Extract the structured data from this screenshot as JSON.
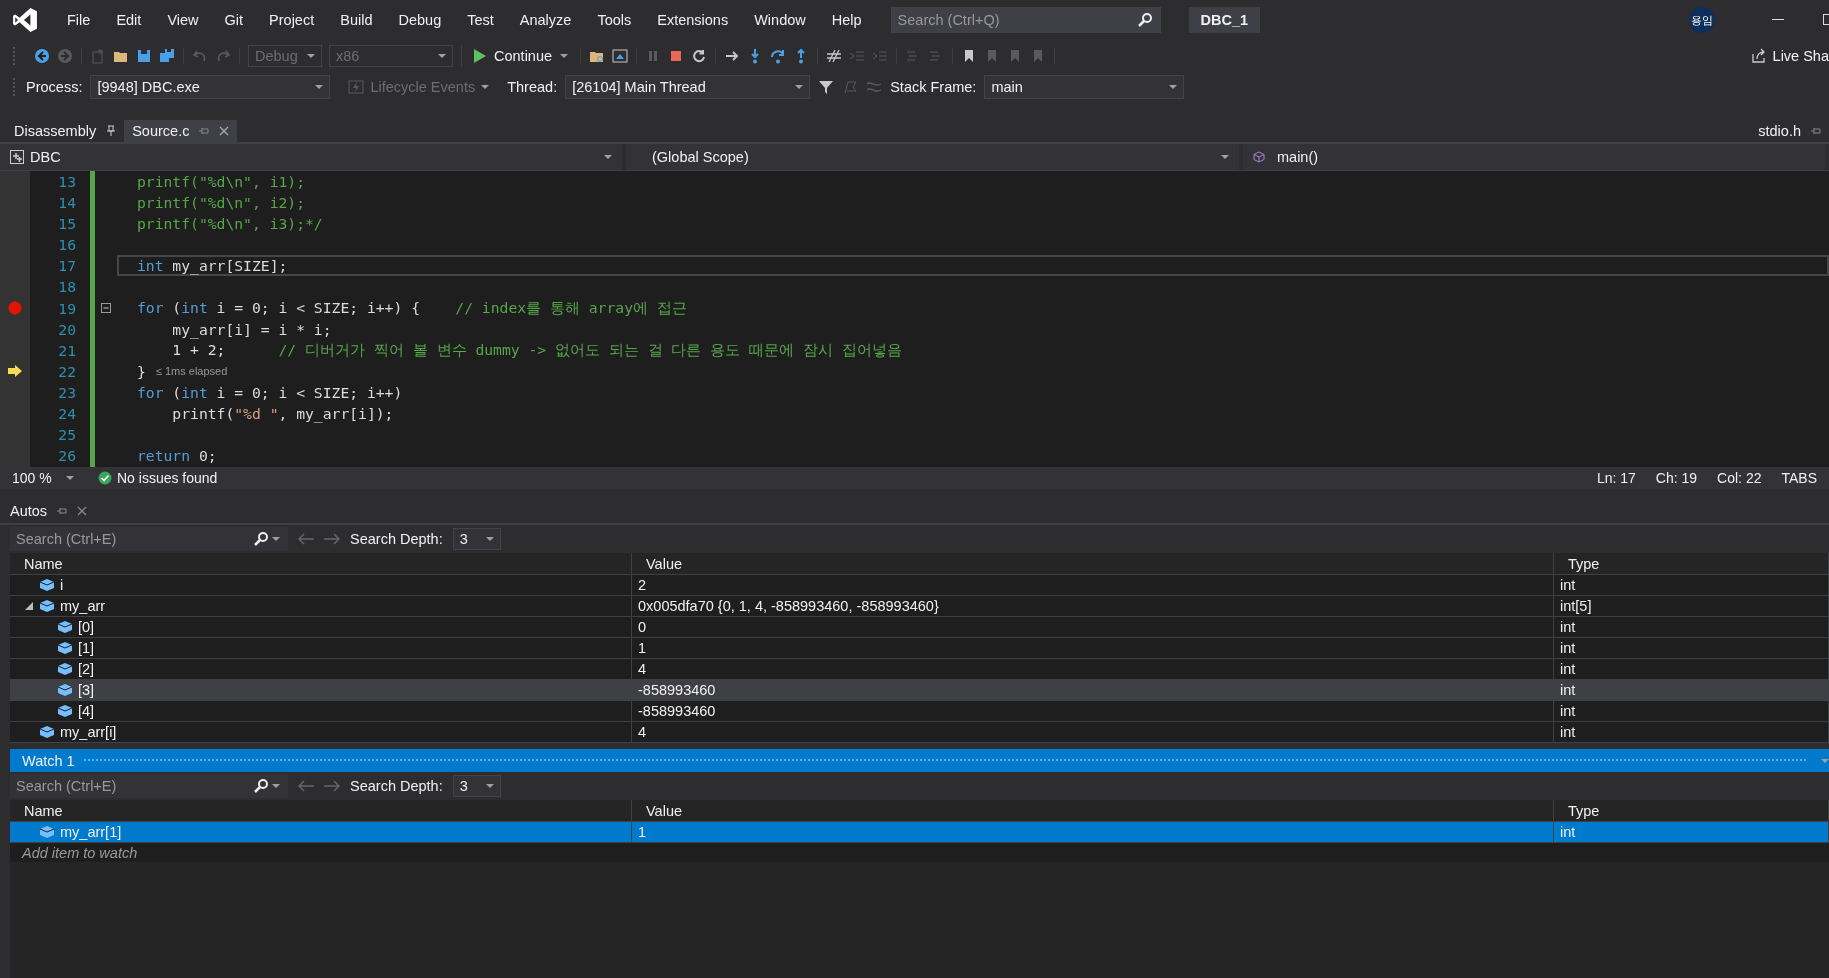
{
  "title_bar": {
    "menu": [
      "File",
      "Edit",
      "View",
      "Git",
      "Project",
      "Build",
      "Debug",
      "Test",
      "Analyze",
      "Tools",
      "Extensions",
      "Window",
      "Help"
    ],
    "search": {
      "placeholder": "Search (Ctrl+Q)"
    },
    "solution_name": "DBC_1",
    "account_initials": "용임"
  },
  "toolbar": [
    [
      {
        "kind": "back",
        "disabled": false
      },
      {
        "kind": "forward",
        "disabled": true
      }
    ],
    [
      {
        "kind": "new-item",
        "disabled": true
      },
      {
        "kind": "open",
        "disabled": false
      },
      {
        "kind": "save",
        "disabled": false
      },
      {
        "kind": "save-all",
        "disabled": false
      }
    ],
    [
      {
        "kind": "undo",
        "disabled": true
      },
      {
        "kind": "redo",
        "disabled": true
      }
    ],
    [
      {
        "kind": "combo",
        "label": "Debug",
        "disabled": true
      },
      {
        "kind": "combo",
        "label": "x86",
        "disabled": true
      }
    ],
    [
      {
        "kind": "continue",
        "label": "Continue",
        "disabled": false
      }
    ],
    [
      {
        "kind": "find-folder",
        "disabled": false
      },
      {
        "kind": "browser",
        "disabled": false
      }
    ],
    [
      {
        "kind": "pause",
        "disabled": true
      },
      {
        "kind": "stop",
        "disabled": false
      },
      {
        "kind": "restart",
        "disabled": false
      }
    ],
    [
      {
        "kind": "show-next",
        "disabled": false
      },
      {
        "kind": "step-into",
        "disabled": false
      },
      {
        "kind": "step-over",
        "disabled": false
      },
      {
        "kind": "step-out",
        "disabled": false
      }
    ],
    [
      {
        "kind": "hex",
        "disabled": false
      },
      {
        "kind": "outdent",
        "disabled": true
      },
      {
        "kind": "indent",
        "disabled": true
      }
    ],
    [
      {
        "kind": "comment",
        "disabled": true
      },
      {
        "kind": "uncomment",
        "disabled": true
      }
    ],
    [
      {
        "kind": "bookmark",
        "disabled": false
      },
      {
        "kind": "bookmark-prev",
        "disabled": true
      },
      {
        "kind": "bookmark-next",
        "disabled": true
      },
      {
        "kind": "bookmark-clear",
        "disabled": true
      }
    ]
  ],
  "live_share": "Live Sha",
  "debug_location": [
    {
      "kind": "label",
      "text": "Process:"
    },
    {
      "kind": "combo",
      "label": "[9948] DBC.exe",
      "disabled": false
    },
    {
      "kind": "lifecycle",
      "label": "Lifecycle Events",
      "disabled": true
    },
    {
      "kind": "label",
      "text": "Thread:"
    },
    {
      "kind": "combo",
      "label": "[26104] Main Thread",
      "disabled": false
    },
    {
      "kind": "filter",
      "disabled": false
    },
    {
      "kind": "flag",
      "disabled": true
    },
    {
      "kind": "threads",
      "disabled": true
    },
    {
      "kind": "label",
      "text": "Stack Frame:"
    },
    {
      "kind": "combo",
      "label": "main",
      "disabled": false
    }
  ],
  "document_tabs": [
    {
      "label": "Disassembly",
      "selected": false,
      "pinned": true
    },
    {
      "label": "Source.c",
      "selected": true,
      "pinned": false
    }
  ],
  "preview_tab": {
    "label": "stdio.h"
  },
  "navigation_bar": {
    "project": "DBC",
    "scope": "(Global Scope)",
    "member": "main()"
  },
  "code_lines": [
    {
      "number": "13",
      "current": false,
      "fold": false,
      "breakpoint": false,
      "execution_point": false,
      "tokens": [
        {
          "kind": "comment",
          "text": "printf(\"%d\\n\", i1);"
        }
      ]
    },
    {
      "number": "14",
      "current": false,
      "fold": false,
      "breakpoint": false,
      "execution_point": false,
      "tokens": [
        {
          "kind": "comment",
          "text": "printf(\"%d\\n\", i2);"
        }
      ]
    },
    {
      "number": "15",
      "current": false,
      "fold": false,
      "breakpoint": false,
      "execution_point": false,
      "tokens": [
        {
          "kind": "comment",
          "text": "printf(\"%d\\n\", i3);*/"
        }
      ]
    },
    {
      "number": "16",
      "current": false,
      "fold": false,
      "breakpoint": false,
      "execution_point": false
    },
    {
      "number": "17",
      "current": true,
      "fold": false,
      "breakpoint": false,
      "execution_point": false,
      "tokens": [
        {
          "kind": "keyword",
          "text": "int"
        },
        {
          "kind": "plain",
          "text": " my_arr[SIZE];"
        }
      ]
    },
    {
      "number": "18",
      "current": false,
      "fold": false,
      "breakpoint": false,
      "execution_point": false
    },
    {
      "number": "19",
      "current": false,
      "fold": true,
      "breakpoint": true,
      "execution_point": false,
      "tokens": [
        {
          "kind": "keyword",
          "text": "for"
        },
        {
          "kind": "plain",
          "text": " ("
        },
        {
          "kind": "keyword",
          "text": "int"
        },
        {
          "kind": "plain",
          "text": " i = 0; i < SIZE; i++) {    "
        },
        {
          "kind": "comment",
          "text": "// index를 통해 array에 접근"
        }
      ]
    },
    {
      "number": "20",
      "current": false,
      "fold": false,
      "breakpoint": false,
      "execution_point": false,
      "tokens": [
        {
          "kind": "plain",
          "text": "    my_arr[i] = i * i;"
        }
      ]
    },
    {
      "number": "21",
      "current": false,
      "fold": false,
      "breakpoint": false,
      "execution_point": false,
      "tokens": [
        {
          "kind": "plain",
          "text": "    1 + 2;      "
        },
        {
          "kind": "comment",
          "text": "// 디버거가 찍어 볼 변수 dummy -> 없어도 되는 걸 다른 용도 때문에 잠시 집어넣음"
        }
      ]
    },
    {
      "number": "22",
      "current": false,
      "fold": false,
      "breakpoint": false,
      "execution_point": true,
      "tokens": [
        {
          "kind": "plain",
          "text": "}"
        }
      ],
      "tip": "≤ 1ms elapsed"
    },
    {
      "number": "23",
      "current": false,
      "fold": false,
      "breakpoint": false,
      "execution_point": false,
      "tokens": [
        {
          "kind": "keyword",
          "text": "for"
        },
        {
          "kind": "plain",
          "text": " ("
        },
        {
          "kind": "keyword",
          "text": "int"
        },
        {
          "kind": "plain",
          "text": " i = 0; i < SIZE; i++)"
        }
      ]
    },
    {
      "number": "24",
      "current": false,
      "fold": false,
      "breakpoint": false,
      "execution_point": false,
      "tokens": [
        {
          "kind": "plain",
          "text": "    printf("
        },
        {
          "kind": "string",
          "text": "\"%d \""
        },
        {
          "kind": "plain",
          "text": ", my_arr[i]);"
        }
      ]
    },
    {
      "number": "25",
      "current": false,
      "fold": false,
      "breakpoint": false,
      "execution_point": false
    },
    {
      "number": "26",
      "current": false,
      "fold": false,
      "breakpoint": false,
      "execution_point": false,
      "tokens": [
        {
          "kind": "keyword",
          "text": "return"
        },
        {
          "kind": "plain",
          "text": " 0;"
        }
      ]
    }
  ],
  "editor_status": {
    "zoom": "100 %",
    "issues": "No issues found",
    "line": "Ln: 17",
    "char": "Ch: 19",
    "col": "Col: 22",
    "indent": "TABS"
  },
  "autos": {
    "title": "Autos",
    "search": {
      "placeholder": "Search (Ctrl+E)"
    },
    "depth_label": "Search Depth:",
    "depth": "3",
    "columns": [
      "Name",
      "Value",
      "Type"
    ],
    "rows": [
      {
        "name": "i",
        "value": "2",
        "type": "int",
        "selected": false
      },
      {
        "name": "my_arr",
        "value": "0x005dfa70 {0, 1, 4, -858993460, -858993460}",
        "type": "int[5]",
        "selected": false,
        "expanded": true,
        "children": [
          {
            "name": "[0]",
            "value": "0",
            "type": "int",
            "selected": false
          },
          {
            "name": "[1]",
            "value": "1",
            "type": "int",
            "selected": false
          },
          {
            "name": "[2]",
            "value": "4",
            "type": "int",
            "selected": false
          },
          {
            "name": "[3]",
            "value": "-858993460",
            "type": "int",
            "selected": true
          },
          {
            "name": "[4]",
            "value": "-858993460",
            "type": "int",
            "selected": false
          }
        ]
      },
      {
        "name": "my_arr[i]",
        "value": "4",
        "type": "int",
        "selected": false
      }
    ]
  },
  "watch": {
    "title": "Watch 1",
    "search": {
      "placeholder": "Search (Ctrl+E)"
    },
    "depth_label": "Search Depth:",
    "depth": "3",
    "columns": [
      "Name",
      "Value",
      "Type"
    ],
    "rows": [
      {
        "name": "my_arr[1]",
        "value": "1",
        "type": "int",
        "selected": true
      }
    ],
    "add_placeholder": "Add item to watch"
  }
}
